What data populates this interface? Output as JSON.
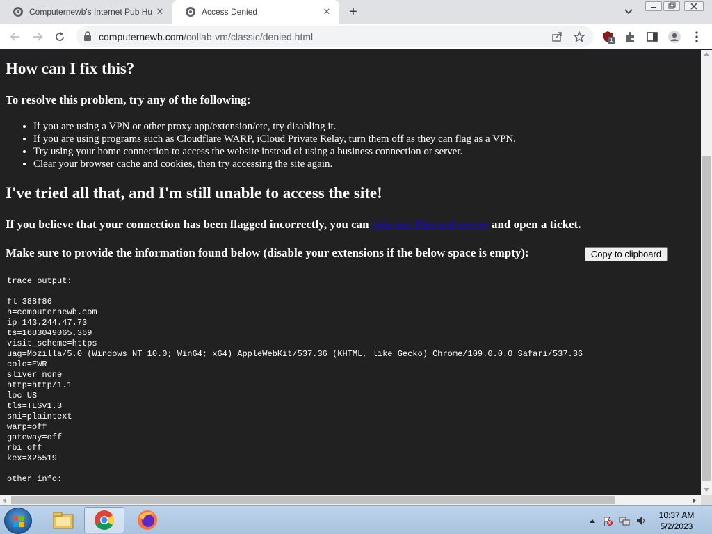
{
  "browser": {
    "tabs": [
      {
        "title": "Computernewb's Internet Pub Hu",
        "active": false,
        "icon": "computernewb-favicon-icon"
      },
      {
        "title": "Access Denied",
        "active": true,
        "icon": "computernewb-favicon-icon"
      }
    ],
    "new_tab_symbol": "+",
    "close_symbol": "✕",
    "url_host": "computernewb.com",
    "url_path": "/collab-vm/classic/denied.html",
    "extension_badge": "1"
  },
  "page": {
    "heading_fix": "How can I fix this?",
    "subheading_resolve": "To resolve this problem, try any of the following:",
    "tips": [
      "If you are using a VPN or other proxy app/extension/etc, try disabling it.",
      "If you are using programs such as Cloudflare WARP, iCloud Private Relay, turn them off as they can flag as a VPN.",
      "Try using your home connection to access the website instead of using a business connection or server.",
      "Clear your browser cache and cookies, then try accessing the site again."
    ],
    "heading_still": "I've tried all that, and I'm still unable to access the site!",
    "flagged_prefix": "If you believe that your connection has been flagged incorrectly, you can ",
    "flagged_link": "join our Discord server",
    "flagged_suffix": " and open a ticket.",
    "provide_info": "Make sure to provide the information found below (disable your extensions if the below space is empty):",
    "copy_button": "Copy to clipboard",
    "trace_label": "trace output:",
    "trace_lines": [
      "fl=388f86",
      "h=computernewb.com",
      "ip=143.244.47.73",
      "ts=1683049065.369",
      "visit_scheme=https",
      "uag=Mozilla/5.0 (Windows NT 10.0; Win64; x64) AppleWebKit/537.36 (KHTML, like Gecko) Chrome/109.0.0.0 Safari/537.36",
      "colo=EWR",
      "sliver=none",
      "http=http/1.1",
      "loc=US",
      "tls=TLSv1.3",
      "sni=plaintext",
      "warp=off",
      "gateway=off",
      "rbi=off",
      "kex=X25519"
    ],
    "other_label": "other info:",
    "colors": {
      "background": "#212121",
      "text": "#ffffff",
      "link": "#1a0dab"
    }
  },
  "taskbar": {
    "items": [
      "windows-explorer-icon",
      "chrome-icon",
      "firefox-icon"
    ],
    "time": "10:37 AM",
    "date": "5/2/2023"
  }
}
